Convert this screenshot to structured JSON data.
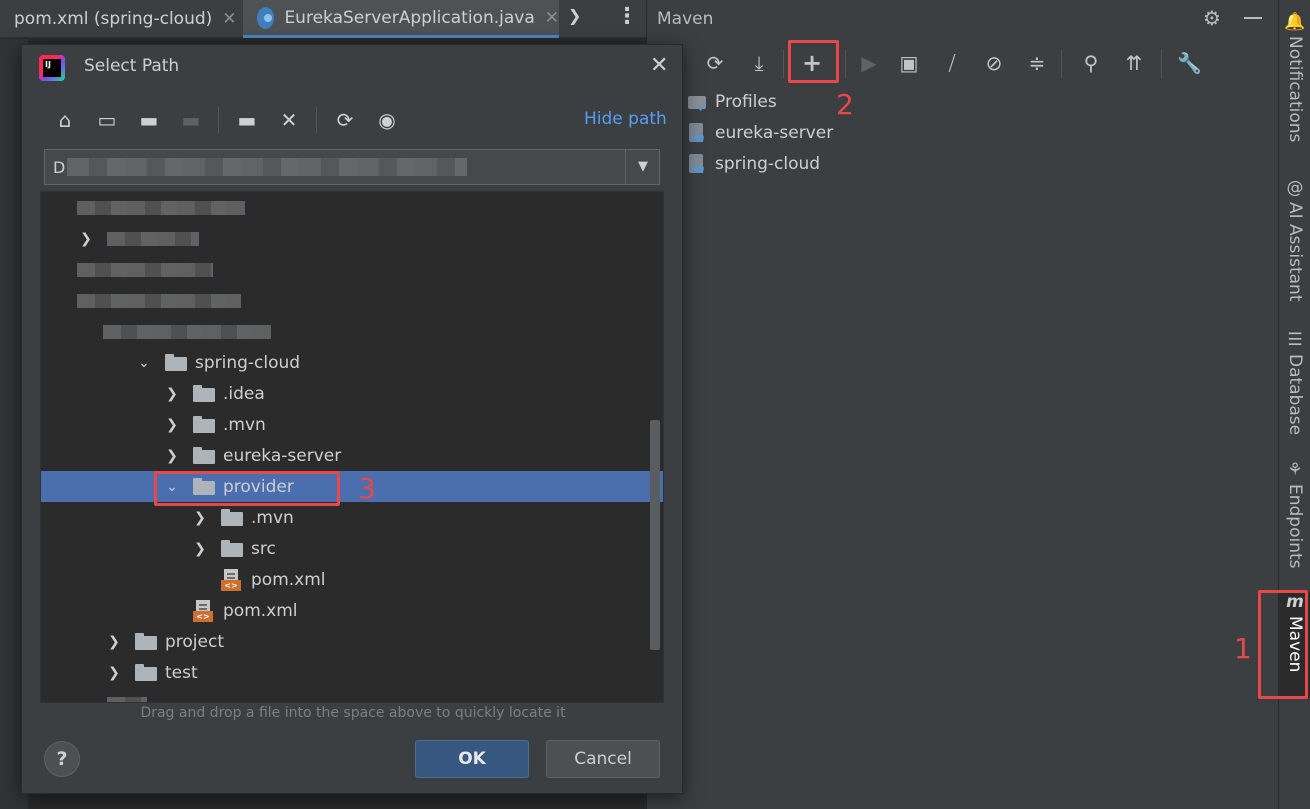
{
  "editor_tabs": [
    {
      "label": "pom.xml (spring-cloud)"
    },
    {
      "label": "EurekaServerApplication.java"
    }
  ],
  "maven": {
    "title": "Maven",
    "tree": [
      {
        "label": "Profiles"
      },
      {
        "label": "eureka-server"
      },
      {
        "label": "spring-cloud"
      }
    ]
  },
  "right_strip": [
    {
      "label": "Notifications",
      "icon": "bell-icon"
    },
    {
      "label": "AI Assistant",
      "icon": "ai-spiral-icon"
    },
    {
      "label": "Database",
      "icon": "database-icon"
    },
    {
      "label": "Endpoints",
      "icon": "endpoints-icon"
    },
    {
      "label": "Maven",
      "icon": "maven-m-icon",
      "active": true
    }
  ],
  "annotations": [
    "1",
    "2",
    "3"
  ],
  "dialog": {
    "title": "Select Path",
    "hide_path_label": "Hide path",
    "path_prefix": "D",
    "drag_hint": "Drag and drop a file into the space above to quickly locate it",
    "help_label": "?",
    "ok_label": "OK",
    "cancel_label": "Cancel",
    "tree": [
      {
        "label": "spring-cloud"
      },
      {
        "label": ".idea"
      },
      {
        "label": ".mvn"
      },
      {
        "label": "eureka-server"
      },
      {
        "label": "provider"
      },
      {
        "label": ".mvn"
      },
      {
        "label": "src"
      },
      {
        "label": "pom.xml"
      },
      {
        "label": "pom.xml"
      },
      {
        "label": "project"
      },
      {
        "label": "test"
      }
    ]
  },
  "colors": {
    "selection": "#4b6eaf",
    "annotation_red": "#e8484a",
    "link_blue": "#589df6",
    "ok_button": "#365880"
  }
}
